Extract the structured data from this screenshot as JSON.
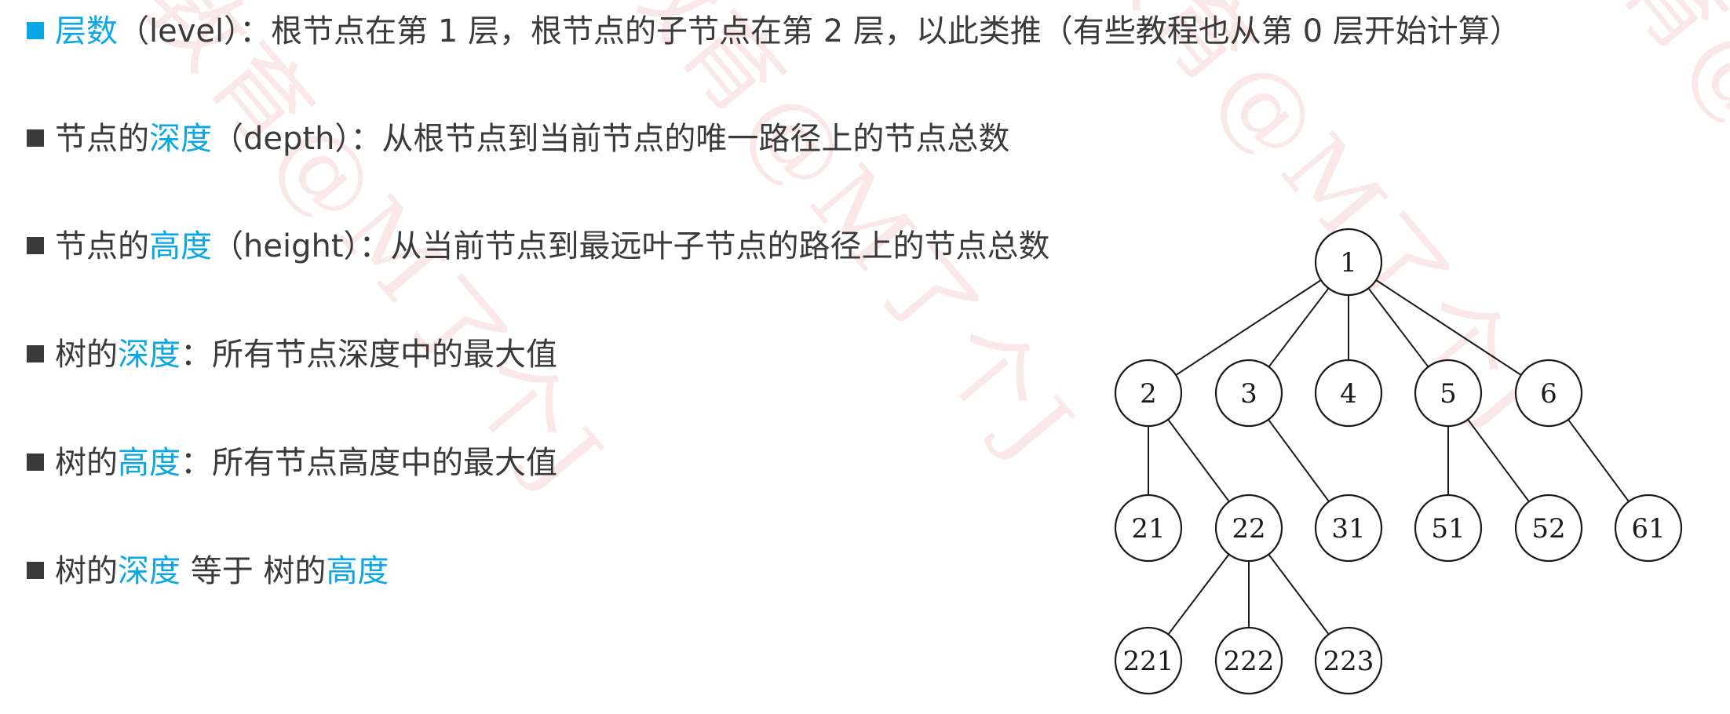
{
  "colors": {
    "accent": "#0aa6e6",
    "text": "#3a3a3a",
    "watermark": "#d20000"
  },
  "watermark_text": "小码哥教育@M了个J",
  "bullets": [
    {
      "segments": [
        {
          "text": "层数",
          "hl": true
        },
        {
          "text": "（level）：根节点在第 1 层，根节点的子节点在第 2 层，以此类推（有些教程也从第 0 层开始计算）",
          "hl": false
        }
      ],
      "accent_bullet": true
    },
    {
      "segments": [
        {
          "text": "节点的",
          "hl": false
        },
        {
          "text": "深度",
          "hl": true
        },
        {
          "text": "（depth）：从根节点到当前节点的唯一路径上的节点总数",
          "hl": false
        }
      ],
      "accent_bullet": false
    },
    {
      "segments": [
        {
          "text": "节点的",
          "hl": false
        },
        {
          "text": "高度",
          "hl": true
        },
        {
          "text": "（height）：从当前节点到最远叶子节点的路径上的节点总数",
          "hl": false
        }
      ],
      "accent_bullet": false
    },
    {
      "segments": [
        {
          "text": "树的",
          "hl": false
        },
        {
          "text": "深度",
          "hl": true
        },
        {
          "text": "：所有节点深度中的最大值",
          "hl": false
        }
      ],
      "accent_bullet": false
    },
    {
      "segments": [
        {
          "text": "树的",
          "hl": false
        },
        {
          "text": "高度",
          "hl": true
        },
        {
          "text": "：所有节点高度中的最大值",
          "hl": false
        }
      ],
      "accent_bullet": false
    },
    {
      "segments": [
        {
          "text": "树的",
          "hl": false
        },
        {
          "text": "深度",
          "hl": true
        },
        {
          "text": " 等于 树的",
          "hl": false
        },
        {
          "text": "高度",
          "hl": true
        }
      ],
      "accent_bullet": false
    }
  ],
  "tree": {
    "nodes": [
      "1",
      "2",
      "3",
      "4",
      "5",
      "6",
      "21",
      "22",
      "31",
      "51",
      "52",
      "61",
      "221",
      "222",
      "223"
    ],
    "edges": [
      [
        "1",
        "2"
      ],
      [
        "1",
        "3"
      ],
      [
        "1",
        "4"
      ],
      [
        "1",
        "5"
      ],
      [
        "1",
        "6"
      ],
      [
        "2",
        "21"
      ],
      [
        "2",
        "22"
      ],
      [
        "3",
        "31"
      ],
      [
        "5",
        "51"
      ],
      [
        "5",
        "52"
      ],
      [
        "6",
        "61"
      ],
      [
        "22",
        "221"
      ],
      [
        "22",
        "222"
      ],
      [
        "22",
        "223"
      ]
    ]
  }
}
